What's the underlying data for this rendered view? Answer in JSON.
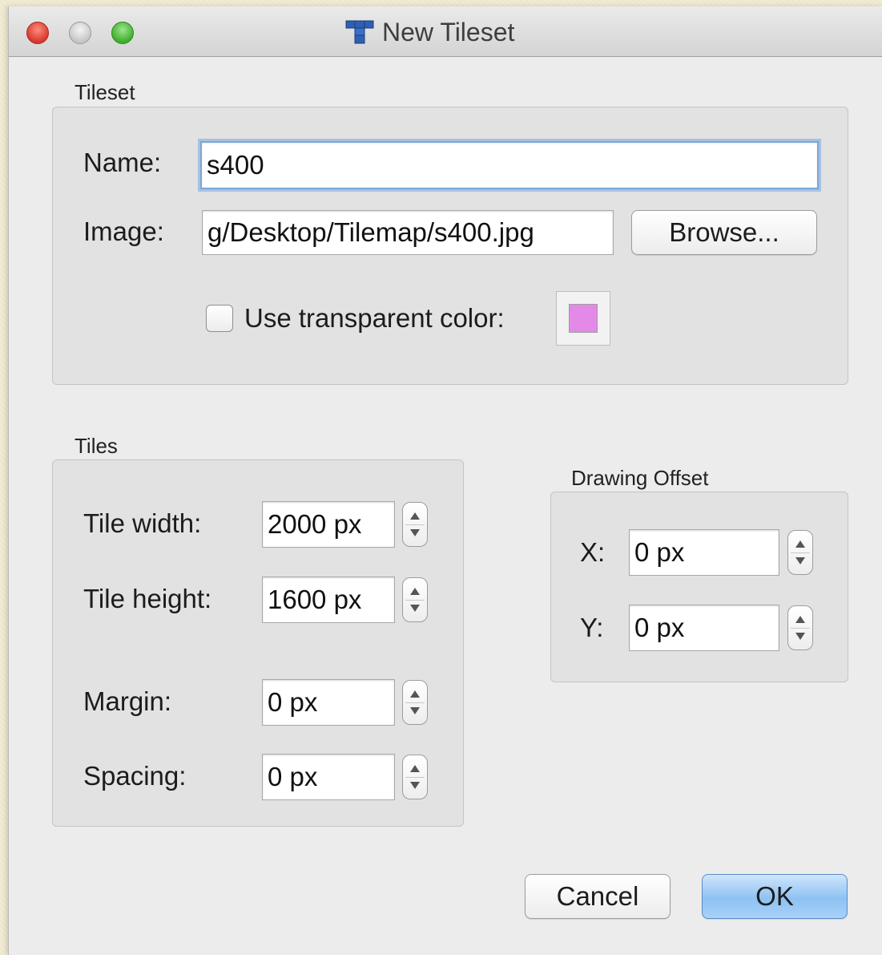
{
  "window": {
    "title": "New Tileset",
    "icon": "tiled-app-icon"
  },
  "tileset": {
    "group_label": "Tileset",
    "name_label": "Name:",
    "name_value": "s400",
    "image_label": "Image:",
    "image_value": "g/Desktop/Tilemap/s400.jpg",
    "browse_label": "Browse...",
    "transparent_label": "Use transparent color:",
    "transparent_checked": false,
    "transparent_color": "#e38ae8"
  },
  "tiles": {
    "group_label": "Tiles",
    "width_label": "Tile width:",
    "width_value": "2000 px",
    "height_label": "Tile height:",
    "height_value": "1600 px",
    "margin_label": "Margin:",
    "margin_value": "0 px",
    "spacing_label": "Spacing:",
    "spacing_value": "0 px"
  },
  "offset": {
    "group_label": "Drawing Offset",
    "x_label": "X:",
    "x_value": "0 px",
    "y_label": "Y:",
    "y_value": "0 px"
  },
  "buttons": {
    "cancel": "Cancel",
    "ok": "OK"
  },
  "colors": {
    "accent_ok": "#8ec2f3",
    "focus_ring": "#7aa7da",
    "close_red": "#d8382c",
    "maximize_green": "#3fae2e"
  }
}
